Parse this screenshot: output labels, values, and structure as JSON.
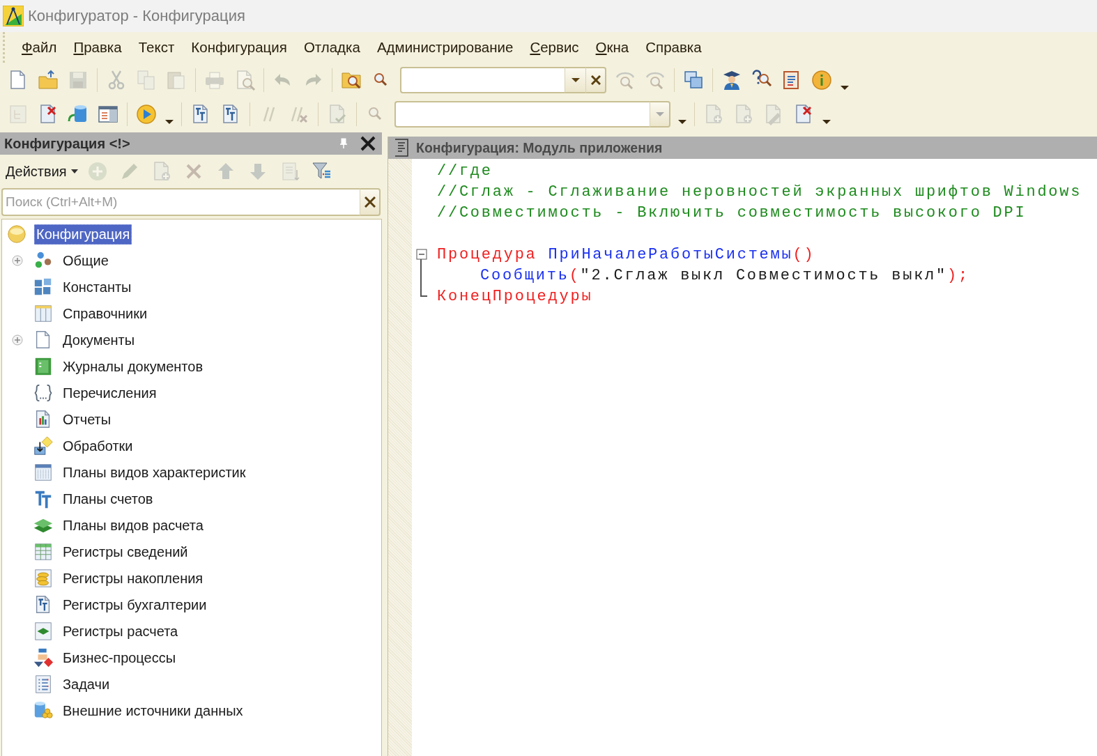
{
  "window": {
    "title": "Конфигуратор - Конфигурация"
  },
  "menu": [
    {
      "label": "Файл",
      "underline_first": true
    },
    {
      "label": "Правка",
      "underline_first": true
    },
    {
      "label": "Текст",
      "underline_first": false
    },
    {
      "label": "Конфигурация",
      "underline_first": false
    },
    {
      "label": "Отладка",
      "underline_first": false
    },
    {
      "label": "Администрирование",
      "underline_first": false
    },
    {
      "label": "Сервис",
      "underline_first": true
    },
    {
      "label": "Окна",
      "underline_first": true
    },
    {
      "label": "Справка",
      "underline_first": false
    }
  ],
  "toolbar1": [
    {
      "kind": "page",
      "disabled": false
    },
    {
      "kind": "folder-arrow",
      "disabled": false
    },
    {
      "kind": "floppy",
      "disabled": true
    },
    {
      "kind": "separator"
    },
    {
      "kind": "scissors",
      "disabled": true
    },
    {
      "kind": "pages",
      "disabled": true
    },
    {
      "kind": "clipboard",
      "disabled": true
    },
    {
      "kind": "separator"
    },
    {
      "kind": "printer",
      "disabled": true
    },
    {
      "kind": "page-magnifier",
      "disabled": true
    },
    {
      "kind": "separator"
    },
    {
      "kind": "arrow-left",
      "disabled": true
    },
    {
      "kind": "arrow-right",
      "disabled": true
    },
    {
      "kind": "separator"
    },
    {
      "kind": "folder-magnifier",
      "disabled": false
    },
    {
      "kind": "magnifier",
      "disabled": false
    },
    {
      "kind": "combo-clear"
    },
    {
      "kind": "arc-magnifier",
      "disabled": true
    },
    {
      "kind": "arc-magnifier",
      "disabled": true
    },
    {
      "kind": "separator"
    },
    {
      "kind": "windows",
      "disabled": false
    },
    {
      "kind": "separator"
    },
    {
      "kind": "person",
      "disabled": false
    },
    {
      "kind": "question-magnifier",
      "disabled": false
    },
    {
      "kind": "book",
      "disabled": false
    },
    {
      "kind": "info",
      "disabled": false
    },
    {
      "kind": "caret",
      "disabled": false
    }
  ],
  "toolbar2": [
    {
      "kind": "tree-page",
      "disabled": true
    },
    {
      "kind": "page-cross",
      "disabled": false
    },
    {
      "kind": "cylinder-arrow",
      "disabled": false
    },
    {
      "kind": "list-window",
      "disabled": false
    },
    {
      "kind": "separator"
    },
    {
      "kind": "play",
      "disabled": false
    },
    {
      "kind": "caret",
      "disabled": false
    },
    {
      "kind": "separator"
    },
    {
      "kind": "letters-page",
      "disabled": false
    },
    {
      "kind": "letters-page",
      "disabled": false
    },
    {
      "kind": "separator"
    },
    {
      "kind": "slashes",
      "disabled": true
    },
    {
      "kind": "slashes-cross",
      "disabled": true
    },
    {
      "kind": "separator"
    },
    {
      "kind": "page-check",
      "disabled": true
    },
    {
      "kind": "separator"
    },
    {
      "kind": "magnifier",
      "disabled": true
    },
    {
      "kind": "combo-inactive"
    },
    {
      "kind": "caret",
      "disabled": false
    },
    {
      "kind": "separator"
    },
    {
      "kind": "page-plus",
      "disabled": true
    },
    {
      "kind": "page-plus",
      "disabled": true
    },
    {
      "kind": "page-pencil",
      "disabled": true
    },
    {
      "kind": "page-cross",
      "disabled": false
    },
    {
      "kind": "caret",
      "disabled": false
    }
  ],
  "left_panel": {
    "title": "Конфигурация <!>",
    "actions_label": "Действия",
    "actions": [
      {
        "kind": "circle-plus",
        "disabled": true
      },
      {
        "kind": "pencil",
        "disabled": true
      },
      {
        "kind": "page-plus",
        "disabled": true
      },
      {
        "kind": "cross",
        "disabled": true
      },
      {
        "kind": "arrow-up",
        "disabled": true
      },
      {
        "kind": "arrow-down",
        "disabled": true
      },
      {
        "kind": "page-lines",
        "disabled": true
      },
      {
        "kind": "funnel",
        "disabled": false
      }
    ],
    "search": {
      "placeholder": "Поиск (Ctrl+Alt+M)"
    },
    "tree": [
      {
        "label": "Конфигурация",
        "kind": "sphere",
        "selected": true,
        "expandable": false,
        "children": [
          {
            "label": "Общие",
            "kind": "circles",
            "selected": false,
            "expandable": true
          },
          {
            "label": "Константы",
            "kind": "blocks",
            "selected": false,
            "expandable": false
          },
          {
            "label": "Справочники",
            "kind": "columns",
            "selected": false,
            "expandable": false
          },
          {
            "label": "Документы",
            "kind": "page",
            "selected": false,
            "expandable": true
          },
          {
            "label": "Журналы документов",
            "kind": "journal-book",
            "selected": false,
            "expandable": false
          },
          {
            "label": "Перечисления",
            "kind": "braces",
            "selected": false,
            "expandable": false
          },
          {
            "label": "Отчеты",
            "kind": "bar-page",
            "selected": false,
            "expandable": false
          },
          {
            "label": "Обработки",
            "kind": "tray-diamond",
            "selected": false,
            "expandable": false
          },
          {
            "label": "Планы видов характеристик",
            "kind": "grid",
            "selected": false,
            "expandable": false
          },
          {
            "label": "Планы счетов",
            "kind": "letters",
            "selected": false,
            "expandable": false
          },
          {
            "label": "Планы видов расчета",
            "kind": "layers",
            "selected": false,
            "expandable": false
          },
          {
            "label": "Регистры сведений",
            "kind": "table-grid",
            "selected": false,
            "expandable": false
          },
          {
            "label": "Регистры накопления",
            "kind": "coins",
            "selected": false,
            "expandable": false
          },
          {
            "label": "Регистры бухгалтерии",
            "kind": "letters-page",
            "selected": false,
            "expandable": false
          },
          {
            "label": "Регистры расчета",
            "kind": "layer-page",
            "selected": false,
            "expandable": false
          },
          {
            "label": "Бизнес-процессы",
            "kind": "flow",
            "selected": false,
            "expandable": false
          },
          {
            "label": "Задачи",
            "kind": "list-page",
            "selected": false,
            "expandable": false
          },
          {
            "label": "Внешние источники данных",
            "kind": "cylinder-coins",
            "selected": false,
            "expandable": false
          }
        ]
      }
    ]
  },
  "editor": {
    "title": "Конфигурация: Модуль приложения",
    "lines": [
      {
        "kind": "plain",
        "tokens": [
          {
            "text": "//где",
            "kind": "comment"
          }
        ]
      },
      {
        "kind": "plain",
        "tokens": [
          {
            "text": "//Сглаж - Сглаживание неровностей экранных шрифтов Windows",
            "kind": "comment"
          }
        ]
      },
      {
        "kind": "plain",
        "tokens": [
          {
            "text": "//Совместимость - Включить совместимость высокого DPI",
            "kind": "comment"
          }
        ]
      },
      {
        "kind": "blank"
      },
      {
        "kind": "fold-start",
        "tokens": [
          {
            "text": "Процедура",
            "kind": "keyword"
          },
          {
            "text": "ПриНачалеРаботыСистемы",
            "kind": "identifier"
          },
          {
            "text": "()",
            "kind": "operator"
          }
        ]
      },
      {
        "kind": "fold-body",
        "tokens": [
          {
            "text": "Сообщить",
            "kind": "identifier"
          },
          {
            "text": "(",
            "kind": "operator"
          },
          {
            "text": "\"2.Сглаж выкл Совместимость выкл\"",
            "kind": "string"
          },
          {
            "text": ");",
            "kind": "operator"
          }
        ],
        "indented": true
      },
      {
        "kind": "fold-end",
        "tokens": [
          {
            "text": "КонецПроцедуры",
            "kind": "keyword"
          }
        ]
      }
    ]
  }
}
